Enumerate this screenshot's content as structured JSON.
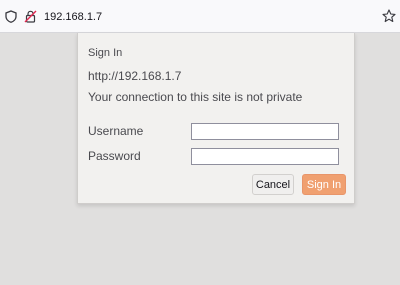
{
  "address_bar": {
    "url": "192.168.1.7",
    "icons": [
      "shield-icon",
      "insecure-lock-icon",
      "bookmark-star-icon"
    ]
  },
  "dialog": {
    "title": "Sign In",
    "site": "http://192.168.1.7",
    "message": "Your connection to this site is not private",
    "username_label": "Username",
    "username_value": "",
    "password_label": "Password",
    "password_value": "",
    "cancel_label": "Cancel",
    "signin_label": "Sign In"
  },
  "colors": {
    "accent": "#f0a070",
    "background": "#e0dfde",
    "dialog": "#f2f1ef"
  }
}
